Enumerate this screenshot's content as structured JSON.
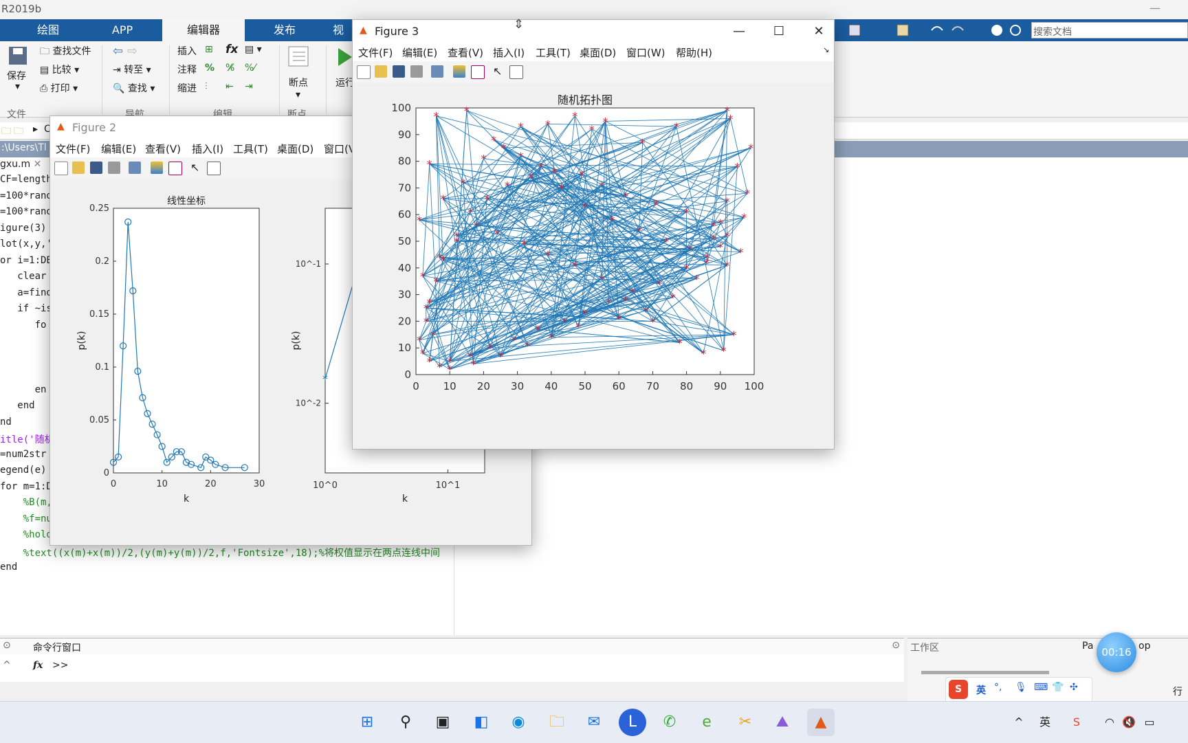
{
  "app": {
    "title": "R2019b",
    "search_placeholder": "搜索文档"
  },
  "ribbon": {
    "tabs": [
      "绘图",
      "APP",
      "编辑器",
      "发布",
      "视"
    ],
    "active_tab": "编辑器",
    "file_group": {
      "save": "保存",
      "find_file": "查找文件",
      "compare": "比较",
      "print": "打印",
      "label": "文件"
    },
    "nav_group": {
      "goto": "转至",
      "find": "查找",
      "label": "导航"
    },
    "edit_group": {
      "insert": "插入",
      "comment": "注释",
      "indent": "缩进",
      "label": "编辑"
    },
    "bp_group": {
      "breakpoints": "断点",
      "label": "断点"
    },
    "run_group": {
      "run": "运行"
    }
  },
  "address": {
    "path_prefix": "C",
    "path": ":\\Users\\Tl"
  },
  "editor": {
    "tab": "gxu.m",
    "lines": [
      "CF=length",
      "=100*rand",
      "=100*rand",
      "igure(3)",
      "lot(x,y,'",
      "or i=1:DE",
      "   clear",
      "   a=find",
      "   if ~is",
      "      fo",
      "",
      "",
      "",
      "      en",
      "   end",
      "nd",
      "itle('随机",
      "=num2str",
      "egend(e)",
      "for m=1:D",
      "    %B(m,m)=m;",
      "    %f=num2str(B(m,m));",
      "    %hold on;",
      "    %text((x(m)+x(m))/2,(y(m)+y(m))/2,f,'Fontsize',18);%将权值显示在两点连线中间",
      "end"
    ]
  },
  "command": {
    "header": "命令行窗口",
    "prompt": ">>",
    "fx": "fx"
  },
  "workspace": {
    "header": "工作区",
    "col_a": "Pa",
    "col_b": "op",
    "row_label": "行"
  },
  "timer": "00:16",
  "ime": {
    "lang": "英",
    "punct": "°,"
  },
  "fig2": {
    "title": "Figure 2",
    "menu": [
      "文件(F)",
      "编辑(E)",
      "查看(V)",
      "插入(I)",
      "工具(T)",
      "桌面(D)",
      "窗口(V"
    ]
  },
  "fig3": {
    "title": "Figure 3",
    "menu": [
      "文件(F)",
      "编辑(E)",
      "查看(V)",
      "插入(I)",
      "工具(T)",
      "桌面(D)",
      "窗口(W)",
      "帮助(H)"
    ]
  },
  "chart_data": [
    {
      "type": "line",
      "title": "线性坐标",
      "xlabel": "k",
      "ylabel": "p(k)",
      "xlim": [
        0,
        30
      ],
      "ylim": [
        0,
        0.25
      ],
      "xticks": [
        0,
        10,
        20,
        30
      ],
      "yticks": [
        0,
        0.05,
        0.1,
        0.15,
        0.2,
        0.25
      ],
      "ytick_labels": [
        "0",
        "0.05",
        "0.1",
        "0.15",
        "0.2",
        "0.25"
      ],
      "series": [
        {
          "x": [
            0,
            1,
            2,
            3,
            4,
            5,
            6,
            7,
            8,
            9,
            10,
            11,
            12,
            13,
            14,
            15,
            16,
            18,
            19,
            20,
            21,
            23,
            27
          ],
          "y": [
            0.01,
            0.015,
            0.12,
            0.237,
            0.172,
            0.096,
            0.071,
            0.056,
            0.046,
            0.036,
            0.025,
            0.01,
            0.015,
            0.02,
            0.02,
            0.01,
            0.008,
            0.005,
            0.015,
            0.012,
            0.008,
            0.005,
            0.005
          ],
          "marker": "o"
        }
      ]
    },
    {
      "type": "line",
      "title": "",
      "xlabel": "k",
      "ylabel": "p(k)",
      "xscale": "log",
      "yscale": "log",
      "xtick_labels": [
        "10^0",
        "10^1"
      ],
      "ytick_labels": [
        "10^-1",
        "10^-2"
      ],
      "series": [
        {
          "x": [
            1,
            2,
            11,
            14,
            16,
            18,
            21
          ],
          "y": [
            0.015,
            0.12,
            0.01,
            0.01,
            0.005,
            0.01,
            0.005
          ],
          "marker": "*"
        }
      ]
    },
    {
      "type": "scatter",
      "title": "随机拓扑图",
      "xlabel": "",
      "ylabel": "",
      "xlim": [
        0,
        100
      ],
      "ylim": [
        0,
        100
      ],
      "xticks": [
        0,
        10,
        20,
        30,
        40,
        50,
        60,
        70,
        80,
        90,
        100
      ],
      "yticks": [
        0,
        10,
        20,
        30,
        40,
        50,
        60,
        70,
        80,
        90,
        100
      ],
      "node_color": "#c0283c",
      "edge_color": "#1f77b4",
      "nodes": {
        "x": [
          6,
          15,
          4,
          23,
          31,
          39,
          47,
          52,
          56,
          67,
          77,
          92,
          93,
          99,
          95,
          98,
          92,
          90,
          97,
          88,
          96,
          92,
          83,
          76,
          68,
          60,
          48,
          40,
          33,
          25,
          17,
          10,
          7,
          4,
          2,
          1,
          3,
          4,
          6,
          8,
          12,
          16,
          21,
          27,
          34,
          41,
          49,
          55,
          62,
          71,
          80,
          88,
          92,
          90,
          86,
          80,
          72,
          64,
          57,
          50,
          44,
          36,
          29,
          22,
          16,
          10,
          5,
          3,
          2,
          1,
          8,
          14,
          20,
          26,
          31,
          37,
          43,
          50,
          58,
          66,
          74,
          81,
          86,
          94,
          91,
          85,
          78,
          70,
          62,
          55,
          47,
          39,
          32,
          24,
          18,
          12,
          7
        ],
        "y": [
          97,
          99,
          79,
          88,
          93,
          94,
          97,
          92,
          95,
          87,
          93,
          99,
          96,
          85,
          78,
          68,
          65,
          57,
          59,
          51,
          46,
          41,
          36,
          29,
          24,
          21,
          18,
          14,
          11,
          7,
          4,
          2,
          3,
          5,
          8,
          13,
          20,
          27,
          35,
          43,
          52,
          61,
          66,
          71,
          74,
          76,
          75,
          71,
          67,
          64,
          61,
          56,
          52,
          48,
          44,
          40,
          34,
          31,
          27,
          23,
          20,
          17,
          13,
          10,
          7,
          5,
          15,
          25,
          37,
          58,
          66,
          72,
          81,
          85,
          82,
          78,
          70,
          63,
          58,
          54,
          50,
          47,
          42,
          15,
          9,
          8,
          12,
          20,
          28,
          36,
          41,
          45,
          49,
          53,
          56,
          50,
          44
        ]
      }
    }
  ]
}
